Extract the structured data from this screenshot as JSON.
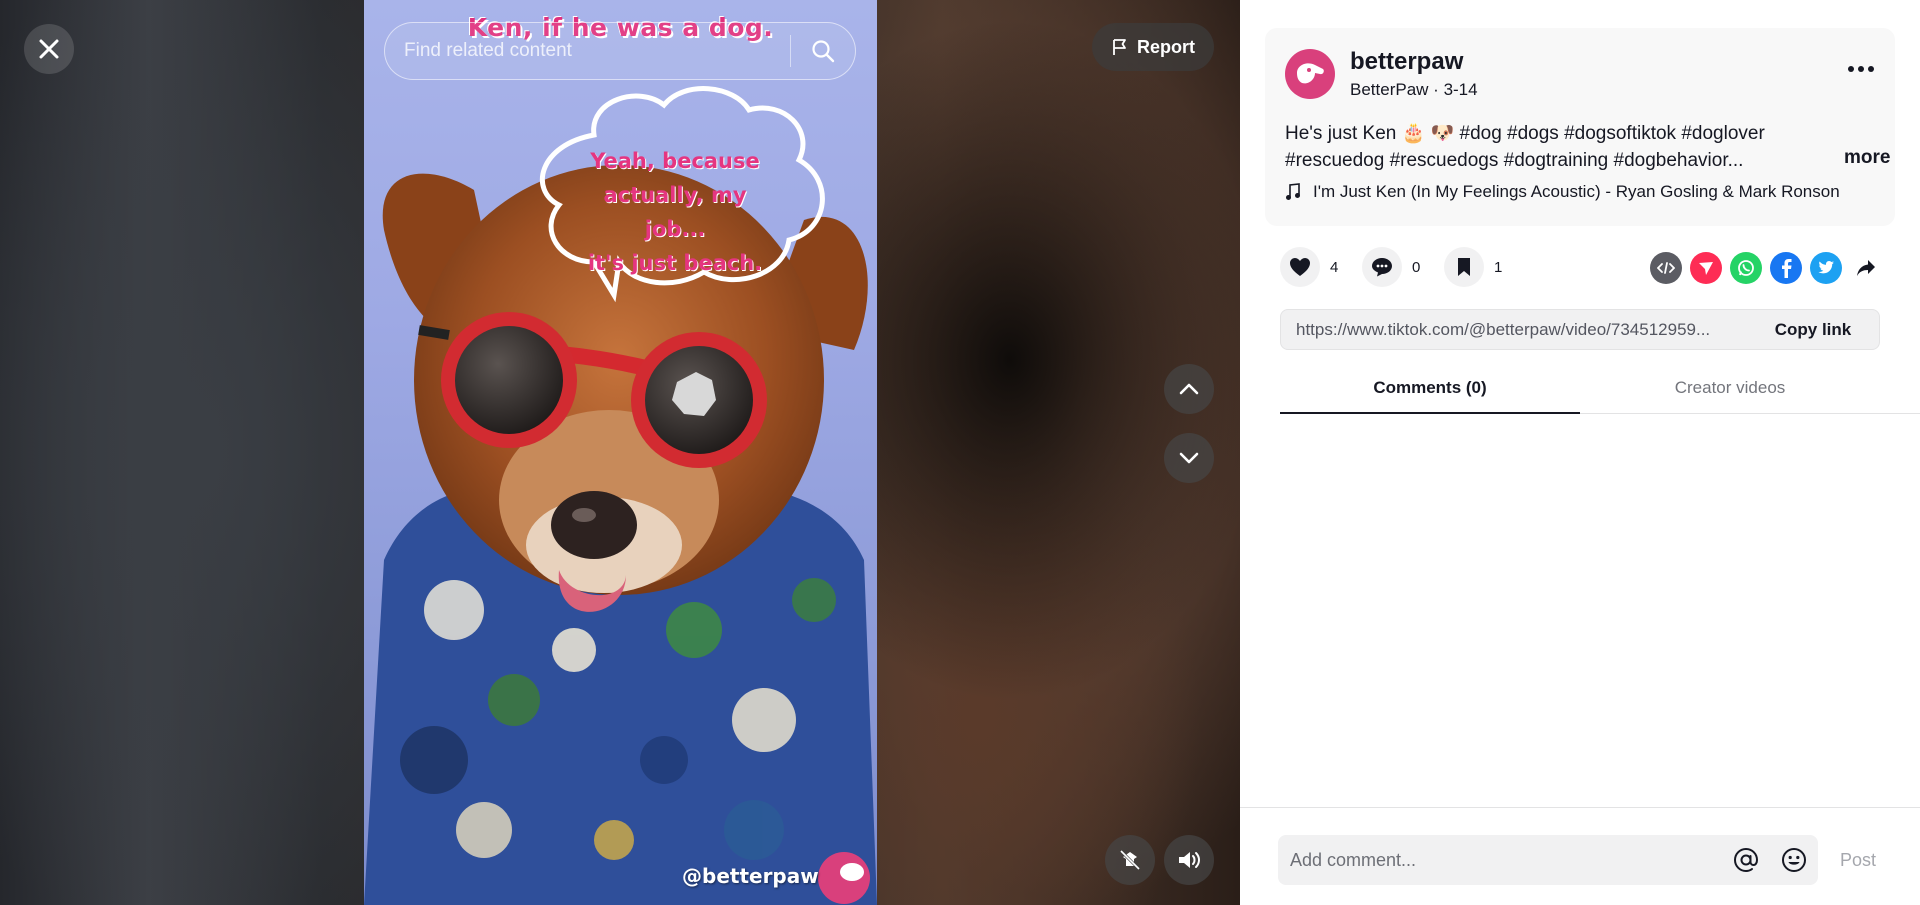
{
  "player": {
    "search_placeholder": "Find related content",
    "report_label": "Report",
    "video_caption_top": "Ken, if he was a dog.",
    "bubble_lines": [
      "Yeah, because",
      "actually, my job...",
      "it's just beach."
    ],
    "watermark": "@betterpaw"
  },
  "post": {
    "username": "betterpaw",
    "display_name": "BetterPaw",
    "date": "3-14",
    "description_line1": "He's just Ken 🎂 🐶 #dog #dogs #dogsoftiktok #doglover",
    "description_line2": "#rescuedog #rescuedogs #dogtraining #dogbehavior...",
    "more_label": "more",
    "music": "I'm Just Ken (In My Feelings Acoustic) - Ryan Gosling & Mark Ronson"
  },
  "actions": {
    "likes": "4",
    "comments": "0",
    "saves": "1"
  },
  "share": [
    "embed-icon",
    "send-to-friends-icon",
    "whatsapp-icon",
    "facebook-icon",
    "twitter-icon",
    "share-arrow-icon"
  ],
  "link": {
    "url": "https://www.tiktok.com/@betterpaw/video/734512959...",
    "copy_label": "Copy link"
  },
  "tabs": {
    "comments": "Comments (0)",
    "creator_videos": "Creator videos"
  },
  "comment_bar": {
    "placeholder": "Add comment...",
    "post_label": "Post"
  },
  "colors": {
    "brand_pink": "#d9407c",
    "whatsapp": "#25d366",
    "facebook": "#1877f2",
    "twitter": "#1da1f2",
    "embed": "#5b5c63",
    "send": "#fe2c55"
  }
}
